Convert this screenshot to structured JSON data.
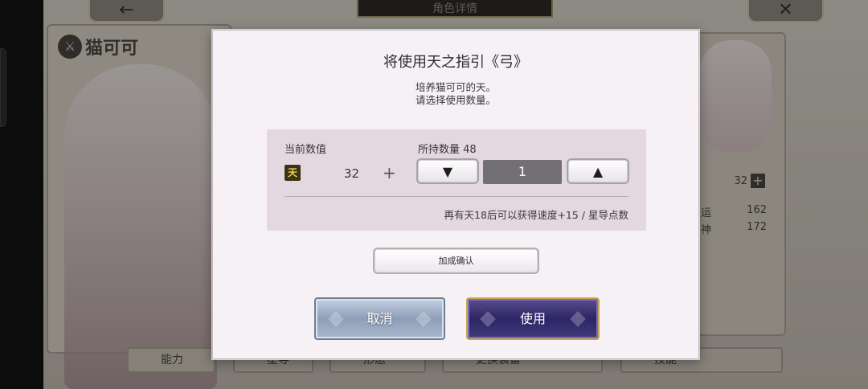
{
  "background": {
    "header_title": "角色详情",
    "back_glyph": "←",
    "close_glyph": "✕",
    "character_name": "猫可可",
    "stats": [
      {
        "label": "",
        "value": "32"
      },
      {
        "label": "运",
        "value": "162"
      },
      {
        "label": "神",
        "value": "172"
      }
    ],
    "bottom_tabs": [
      "能力",
      "星导",
      "形态",
      "更换装备",
      "技能"
    ]
  },
  "dialog": {
    "title": "将使用天之指引《弓》",
    "desc_line1": "培养猫可可的天。",
    "desc_line2": "请选择使用数量。",
    "current_value_label": "当前数值",
    "owned_label": "所持数量 48",
    "stat_icon_text": "天",
    "current_value": "32",
    "plus": "+",
    "decrease_glyph": "▼",
    "increase_glyph": "▲",
    "quantity": "1",
    "hint": "再有天18后可以获得速度+15 / 星导点数",
    "confirm_add_label": "加成确认",
    "cancel_label": "取消",
    "use_label": "使用"
  }
}
